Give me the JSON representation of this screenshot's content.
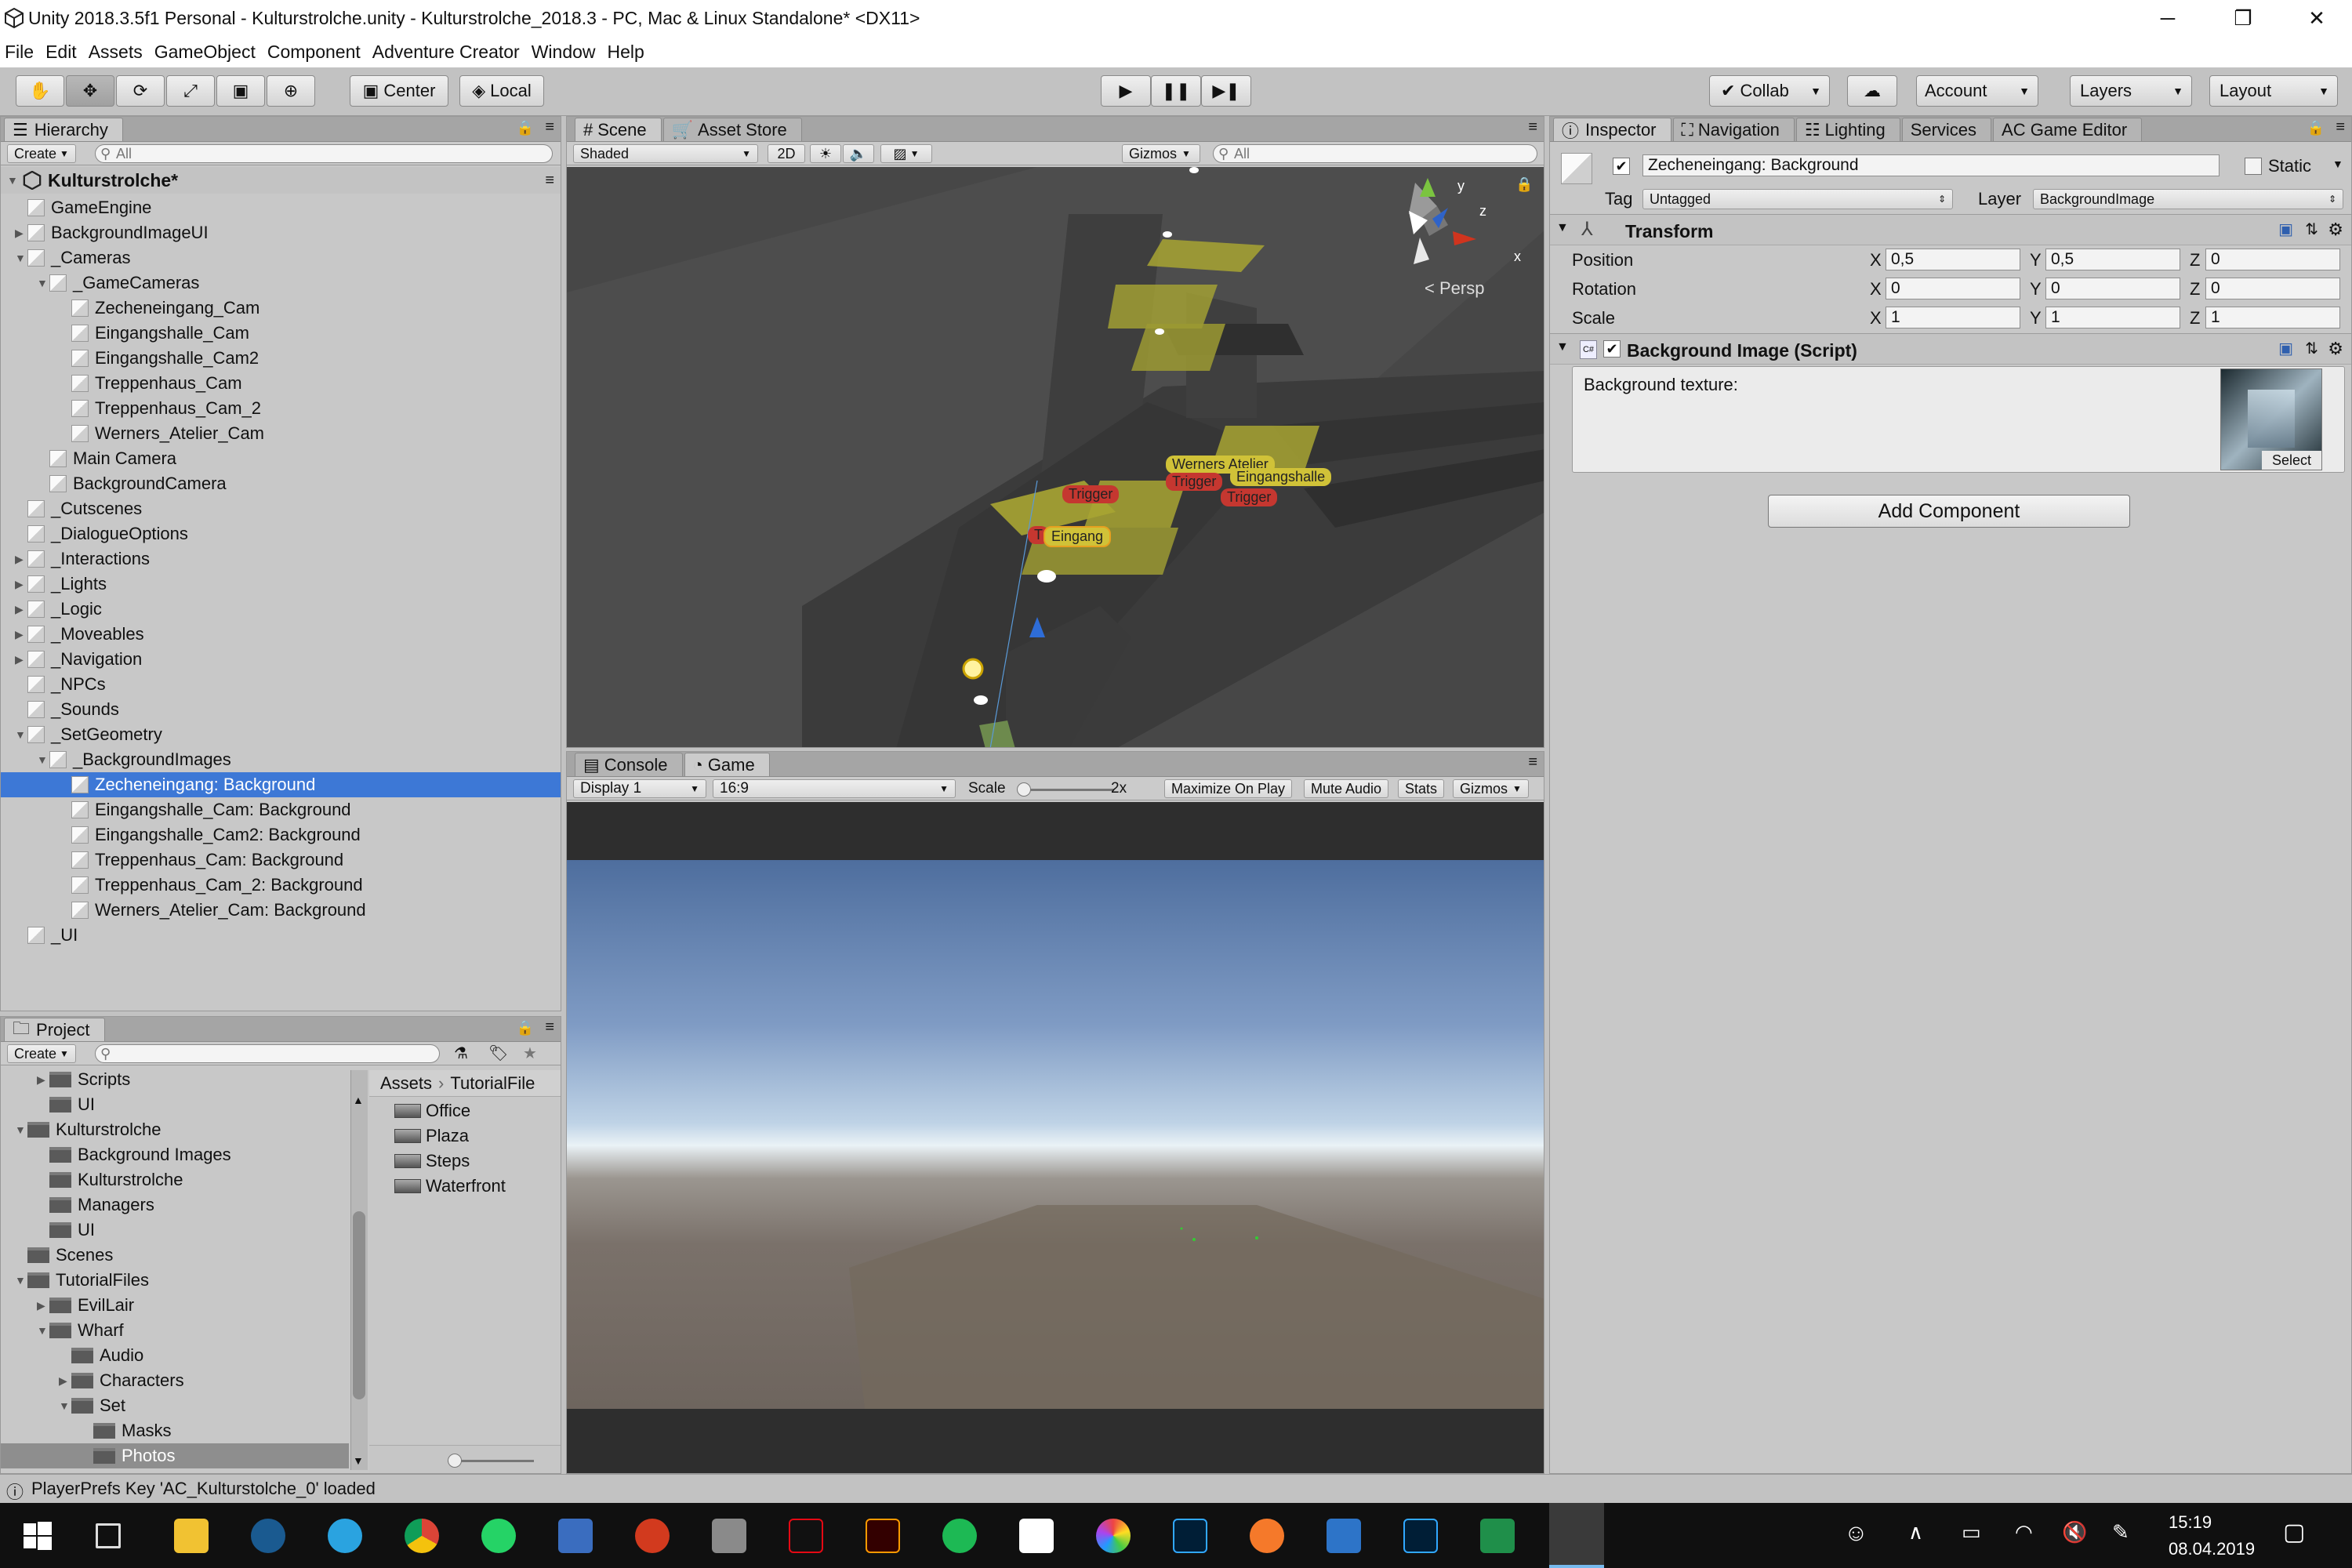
{
  "window": {
    "title": "Unity 2018.3.5f1 Personal - Kulturstrolche.unity - Kulturstrolche_2018.3 - PC, Mac & Linux Standalone* <DX11>",
    "minimize": "─",
    "restore": "❐",
    "close": "✕"
  },
  "menu": [
    "File",
    "Edit",
    "Assets",
    "GameObject",
    "Component",
    "Adventure Creator",
    "Window",
    "Help"
  ],
  "toolbar": {
    "center": "Center",
    "local": "Local",
    "collab": "Collab",
    "account": "Account",
    "layers": "Layers",
    "layout": "Layout",
    "play": "▶",
    "pause": "❚❚",
    "step": "▶❚"
  },
  "hierarchy": {
    "tab": "Hierarchy",
    "create": "Create",
    "search": "All",
    "scene": "Kulturstrolche*",
    "items": [
      {
        "label": "GameEngine",
        "d": 0,
        "exp": ""
      },
      {
        "label": "BackgroundImageUI",
        "d": 0,
        "exp": "▶"
      },
      {
        "label": "_Cameras",
        "d": 0,
        "exp": "▼"
      },
      {
        "label": "_GameCameras",
        "d": 1,
        "exp": "▼"
      },
      {
        "label": "Zecheneingang_Cam",
        "d": 2,
        "exp": ""
      },
      {
        "label": "Eingangshalle_Cam",
        "d": 2,
        "exp": ""
      },
      {
        "label": "Eingangshalle_Cam2",
        "d": 2,
        "exp": ""
      },
      {
        "label": "Treppenhaus_Cam",
        "d": 2,
        "exp": ""
      },
      {
        "label": "Treppenhaus_Cam_2",
        "d": 2,
        "exp": ""
      },
      {
        "label": "Werners_Atelier_Cam",
        "d": 2,
        "exp": ""
      },
      {
        "label": "Main Camera",
        "d": 1,
        "exp": ""
      },
      {
        "label": "BackgroundCamera",
        "d": 1,
        "exp": ""
      },
      {
        "label": "_Cutscenes",
        "d": 0,
        "exp": ""
      },
      {
        "label": "_DialogueOptions",
        "d": 0,
        "exp": ""
      },
      {
        "label": "_Interactions",
        "d": 0,
        "exp": "▶"
      },
      {
        "label": "_Lights",
        "d": 0,
        "exp": "▶"
      },
      {
        "label": "_Logic",
        "d": 0,
        "exp": "▶"
      },
      {
        "label": "_Moveables",
        "d": 0,
        "exp": "▶"
      },
      {
        "label": "_Navigation",
        "d": 0,
        "exp": "▶"
      },
      {
        "label": "_NPCs",
        "d": 0,
        "exp": ""
      },
      {
        "label": "_Sounds",
        "d": 0,
        "exp": ""
      },
      {
        "label": "_SetGeometry",
        "d": 0,
        "exp": "▼"
      },
      {
        "label": "_BackgroundImages",
        "d": 1,
        "exp": "▼"
      },
      {
        "label": "Zecheneingang: Background",
        "d": 2,
        "exp": "",
        "sel": true
      },
      {
        "label": "Eingangshalle_Cam: Background",
        "d": 2,
        "exp": ""
      },
      {
        "label": "Eingangshalle_Cam2: Background",
        "d": 2,
        "exp": ""
      },
      {
        "label": "Treppenhaus_Cam: Background",
        "d": 2,
        "exp": ""
      },
      {
        "label": "Treppenhaus_Cam_2: Background",
        "d": 2,
        "exp": ""
      },
      {
        "label": "Werners_Atelier_Cam: Background",
        "d": 2,
        "exp": ""
      },
      {
        "label": "_UI",
        "d": 0,
        "exp": ""
      }
    ]
  },
  "project": {
    "tab": "Project",
    "create": "Create",
    "tree": [
      {
        "label": "Scripts",
        "d": 1,
        "exp": "▶"
      },
      {
        "label": "UI",
        "d": 1,
        "exp": ""
      },
      {
        "label": "Kulturstrolche",
        "d": 0,
        "exp": "▼"
      },
      {
        "label": "Background Images",
        "d": 1,
        "exp": ""
      },
      {
        "label": "Kulturstrolche",
        "d": 1,
        "exp": ""
      },
      {
        "label": "Managers",
        "d": 1,
        "exp": ""
      },
      {
        "label": "UI",
        "d": 1,
        "exp": ""
      },
      {
        "label": "Scenes",
        "d": 0,
        "exp": ""
      },
      {
        "label": "TutorialFiles",
        "d": 0,
        "exp": "▼"
      },
      {
        "label": "EvilLair",
        "d": 1,
        "exp": "▶"
      },
      {
        "label": "Wharf",
        "d": 1,
        "exp": "▼"
      },
      {
        "label": "Audio",
        "d": 2,
        "exp": ""
      },
      {
        "label": "Characters",
        "d": 2,
        "exp": "▶"
      },
      {
        "label": "Set",
        "d": 2,
        "exp": "▼"
      },
      {
        "label": "Masks",
        "d": 3,
        "exp": ""
      },
      {
        "label": "Photos",
        "d": 3,
        "exp": "",
        "sel": true
      }
    ],
    "breadcrumb": [
      "Assets",
      "TutorialFile"
    ],
    "assets": [
      "Office",
      "Plaza",
      "Steps",
      "Waterfront"
    ]
  },
  "scene": {
    "tab_scene": "Scene",
    "tab_store": "Asset Store",
    "shaded": "Shaded",
    "mode2d": "2D",
    "gizmos": "Gizmos",
    "search": "All",
    "persp": "Persp",
    "labels": {
      "trigger1": "Trigger",
      "eingang": "Eingang",
      "werners": "Werners Atelier",
      "eingangshalle": "Eingangshalle",
      "trigger2": "Trigger",
      "trigger3": "Trigger",
      "t": "T"
    },
    "gizmo": {
      "y": "y",
      "z": "z",
      "x": "x"
    }
  },
  "game": {
    "tab_console": "Console",
    "tab_game": "Game",
    "display": "Display 1",
    "aspect": "16:9",
    "scale": "Scale",
    "scale_val": "2x",
    "maximize": "Maximize On Play",
    "mute": "Mute Audio",
    "stats": "Stats",
    "gizmos": "Gizmos"
  },
  "inspector": {
    "tabs": [
      "Inspector",
      "Navigation",
      "Lighting",
      "Services",
      "AC Game Editor"
    ],
    "name": "Zecheneingang: Background",
    "static": "Static",
    "tag_lbl": "Tag",
    "tag": "Untagged",
    "layer_lbl": "Layer",
    "layer": "BackgroundImage",
    "transform": {
      "title": "Transform",
      "position": "Position",
      "rotation": "Rotation",
      "scale": "Scale",
      "pos": [
        "0,5",
        "0,5",
        "0"
      ],
      "rot": [
        "0",
        "0",
        "0"
      ],
      "scl": [
        "1",
        "1",
        "1"
      ]
    },
    "bgscript": {
      "title": "Background Image (Script)",
      "texture_lbl": "Background texture:",
      "select": "Select"
    },
    "add_component": "Add Component"
  },
  "status": "PlayerPrefs Key 'AC_Kulturstolche_0' loaded",
  "clock": {
    "time": "15:19",
    "date": "08.04.2019"
  },
  "taskbar_icons": [
    "windows-start",
    "task-view",
    "file-explorer",
    "steam",
    "telegram",
    "chrome",
    "whatsapp",
    "app",
    "app",
    "app",
    "netflix",
    "illustrator",
    "spotify",
    "app",
    "app",
    "photoshop",
    "blender",
    "app",
    "lightroom",
    "app",
    "unity"
  ]
}
